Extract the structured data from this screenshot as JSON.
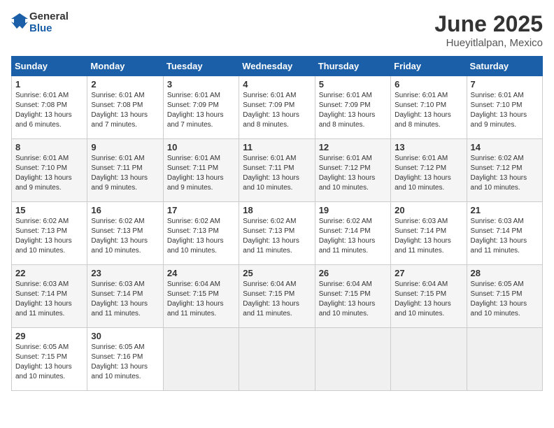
{
  "header": {
    "logo_general": "General",
    "logo_blue": "Blue",
    "title": "June 2025",
    "subtitle": "Hueyitlalpan, Mexico"
  },
  "weekdays": [
    "Sunday",
    "Monday",
    "Tuesday",
    "Wednesday",
    "Thursday",
    "Friday",
    "Saturday"
  ],
  "weeks": [
    [
      {
        "day": "1",
        "sunrise": "6:01 AM",
        "sunset": "7:08 PM",
        "daylight": "13 hours and 6 minutes."
      },
      {
        "day": "2",
        "sunrise": "6:01 AM",
        "sunset": "7:08 PM",
        "daylight": "13 hours and 7 minutes."
      },
      {
        "day": "3",
        "sunrise": "6:01 AM",
        "sunset": "7:09 PM",
        "daylight": "13 hours and 7 minutes."
      },
      {
        "day": "4",
        "sunrise": "6:01 AM",
        "sunset": "7:09 PM",
        "daylight": "13 hours and 8 minutes."
      },
      {
        "day": "5",
        "sunrise": "6:01 AM",
        "sunset": "7:09 PM",
        "daylight": "13 hours and 8 minutes."
      },
      {
        "day": "6",
        "sunrise": "6:01 AM",
        "sunset": "7:10 PM",
        "daylight": "13 hours and 8 minutes."
      },
      {
        "day": "7",
        "sunrise": "6:01 AM",
        "sunset": "7:10 PM",
        "daylight": "13 hours and 9 minutes."
      }
    ],
    [
      {
        "day": "8",
        "sunrise": "6:01 AM",
        "sunset": "7:10 PM",
        "daylight": "13 hours and 9 minutes."
      },
      {
        "day": "9",
        "sunrise": "6:01 AM",
        "sunset": "7:11 PM",
        "daylight": "13 hours and 9 minutes."
      },
      {
        "day": "10",
        "sunrise": "6:01 AM",
        "sunset": "7:11 PM",
        "daylight": "13 hours and 9 minutes."
      },
      {
        "day": "11",
        "sunrise": "6:01 AM",
        "sunset": "7:11 PM",
        "daylight": "13 hours and 10 minutes."
      },
      {
        "day": "12",
        "sunrise": "6:01 AM",
        "sunset": "7:12 PM",
        "daylight": "13 hours and 10 minutes."
      },
      {
        "day": "13",
        "sunrise": "6:01 AM",
        "sunset": "7:12 PM",
        "daylight": "13 hours and 10 minutes."
      },
      {
        "day": "14",
        "sunrise": "6:02 AM",
        "sunset": "7:12 PM",
        "daylight": "13 hours and 10 minutes."
      }
    ],
    [
      {
        "day": "15",
        "sunrise": "6:02 AM",
        "sunset": "7:13 PM",
        "daylight": "13 hours and 10 minutes."
      },
      {
        "day": "16",
        "sunrise": "6:02 AM",
        "sunset": "7:13 PM",
        "daylight": "13 hours and 10 minutes."
      },
      {
        "day": "17",
        "sunrise": "6:02 AM",
        "sunset": "7:13 PM",
        "daylight": "13 hours and 10 minutes."
      },
      {
        "day": "18",
        "sunrise": "6:02 AM",
        "sunset": "7:13 PM",
        "daylight": "13 hours and 11 minutes."
      },
      {
        "day": "19",
        "sunrise": "6:02 AM",
        "sunset": "7:14 PM",
        "daylight": "13 hours and 11 minutes."
      },
      {
        "day": "20",
        "sunrise": "6:03 AM",
        "sunset": "7:14 PM",
        "daylight": "13 hours and 11 minutes."
      },
      {
        "day": "21",
        "sunrise": "6:03 AM",
        "sunset": "7:14 PM",
        "daylight": "13 hours and 11 minutes."
      }
    ],
    [
      {
        "day": "22",
        "sunrise": "6:03 AM",
        "sunset": "7:14 PM",
        "daylight": "13 hours and 11 minutes."
      },
      {
        "day": "23",
        "sunrise": "6:03 AM",
        "sunset": "7:14 PM",
        "daylight": "13 hours and 11 minutes."
      },
      {
        "day": "24",
        "sunrise": "6:04 AM",
        "sunset": "7:15 PM",
        "daylight": "13 hours and 11 minutes."
      },
      {
        "day": "25",
        "sunrise": "6:04 AM",
        "sunset": "7:15 PM",
        "daylight": "13 hours and 11 minutes."
      },
      {
        "day": "26",
        "sunrise": "6:04 AM",
        "sunset": "7:15 PM",
        "daylight": "13 hours and 10 minutes."
      },
      {
        "day": "27",
        "sunrise": "6:04 AM",
        "sunset": "7:15 PM",
        "daylight": "13 hours and 10 minutes."
      },
      {
        "day": "28",
        "sunrise": "6:05 AM",
        "sunset": "7:15 PM",
        "daylight": "13 hours and 10 minutes."
      }
    ],
    [
      {
        "day": "29",
        "sunrise": "6:05 AM",
        "sunset": "7:15 PM",
        "daylight": "13 hours and 10 minutes."
      },
      {
        "day": "30",
        "sunrise": "6:05 AM",
        "sunset": "7:16 PM",
        "daylight": "13 hours and 10 minutes."
      },
      null,
      null,
      null,
      null,
      null
    ]
  ],
  "labels": {
    "sunrise": "Sunrise:",
    "sunset": "Sunset:",
    "daylight": "Daylight:"
  }
}
